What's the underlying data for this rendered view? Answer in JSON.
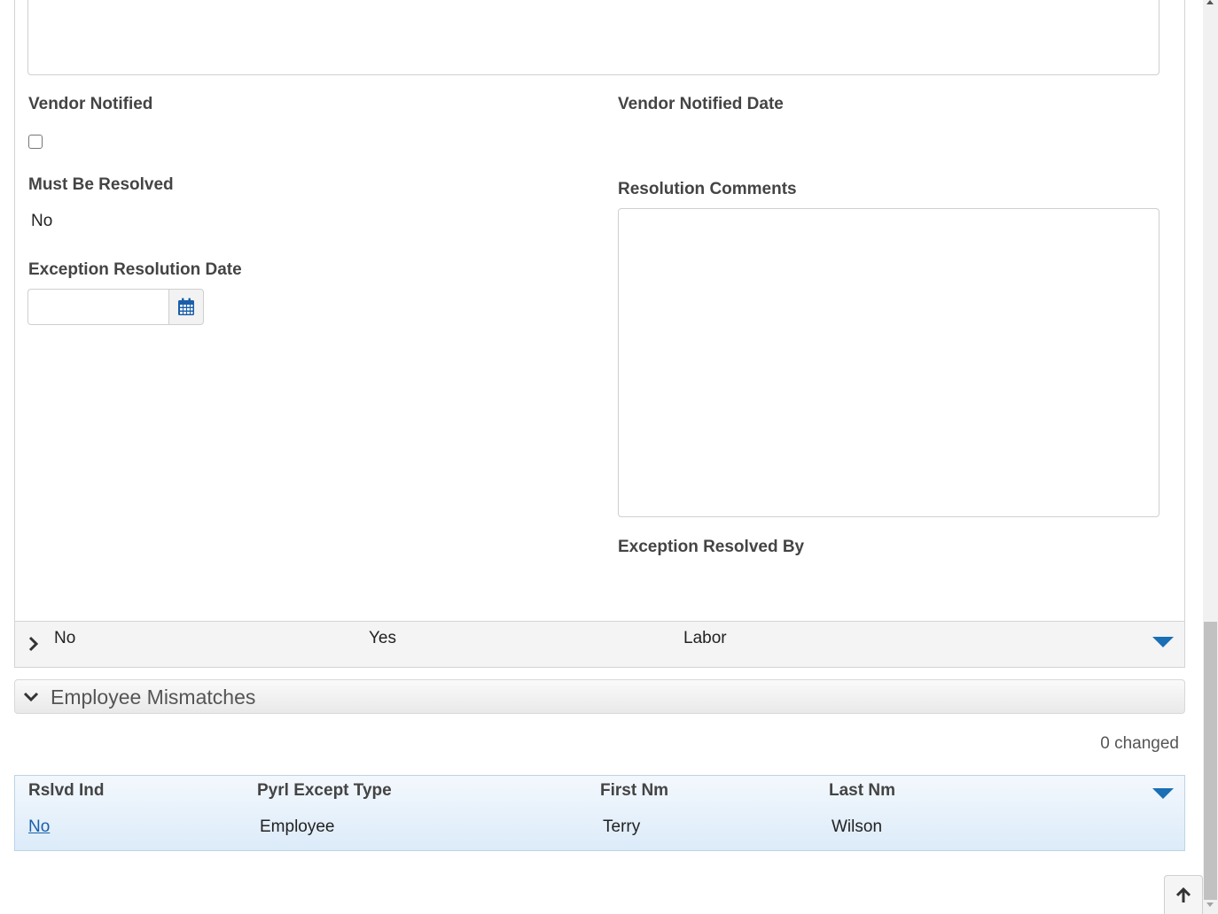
{
  "form": {
    "vendor_notified_label": "Vendor Notified",
    "vendor_notified_date_label": "Vendor Notified Date",
    "must_be_resolved_label": "Must Be Resolved",
    "must_be_resolved_value": "No",
    "resolution_comments_label": "Resolution Comments",
    "exception_resolution_date_label": "Exception Resolution Date",
    "exception_resolution_date_value": "",
    "exception_resolved_by_label": "Exception Resolved By"
  },
  "summary_row": {
    "col1": "No",
    "col2": "Yes",
    "col3": "Labor"
  },
  "section": {
    "title": "Employee Mismatches",
    "changed_text": "0 changed"
  },
  "grid": {
    "headers": [
      "Rslvd Ind",
      "Pyrl Except Type",
      "First Nm",
      "Last Nm"
    ],
    "rows": [
      [
        "No",
        "Employee",
        "Terry",
        "Wilson"
      ]
    ]
  },
  "icons": {
    "calendar": "calendar-icon",
    "expand": "chevron-right-icon",
    "collapse": "chevron-down-icon",
    "menu": "triangle-down-icon",
    "back_to_top": "arrow-up-icon"
  },
  "colors": {
    "accent": "#1a6fb5",
    "grid_bg": "#dcebf9",
    "link": "#1a5fa8"
  }
}
